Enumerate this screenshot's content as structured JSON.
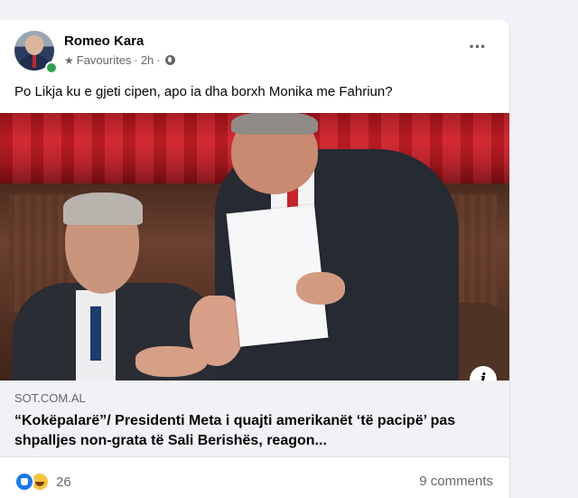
{
  "post": {
    "author": "Romeo Kara",
    "audience": "Favourites",
    "separator": "·",
    "time": "2h",
    "text": "Po Likja ku e gjeti cipen, apo ia dha borxh Monika me Fahriun?",
    "more_icon": "more-horizontal-icon"
  },
  "link": {
    "domain": "SOT.COM.AL",
    "title": "“Kokëpalarë”/ Presidenti Meta i quajti amerikanët ‘të pacipë’ pas shpalljes non-grata të Sali Berishës, reagon..."
  },
  "footer": {
    "reaction_count": "26",
    "comments": "9 comments"
  },
  "colors": {
    "background": "#f0f2f5",
    "card": "#ffffff",
    "like_blue": "#1877f2",
    "secondary_text": "#65676b",
    "online_green": "#31a24c"
  }
}
